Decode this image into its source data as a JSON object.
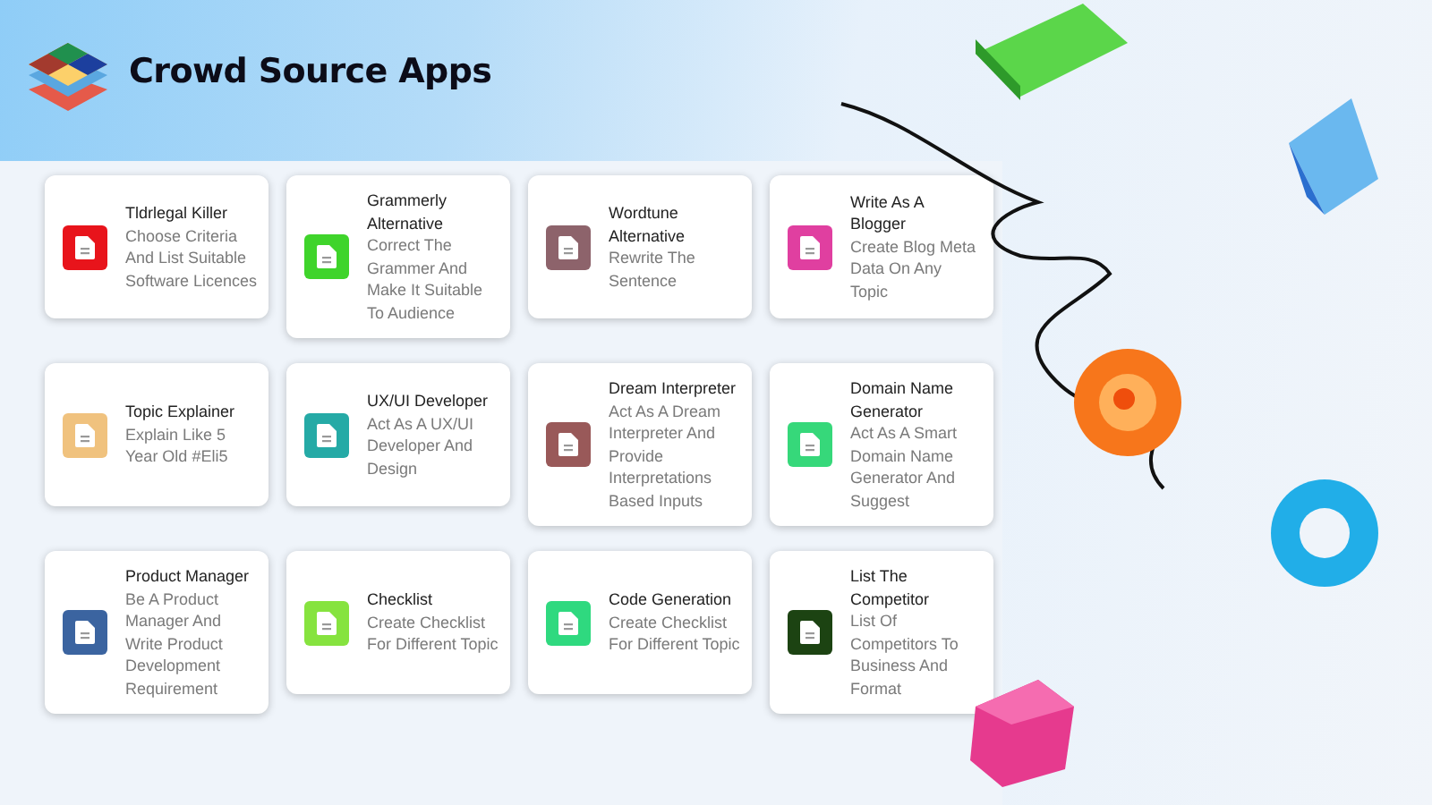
{
  "header": {
    "title": "Crowd Source Apps"
  },
  "apps": [
    {
      "title": "Tldrlegal Killer",
      "description": "Choose Criteria And List Suitable Software Licences",
      "color": "#e8141b"
    },
    {
      "title": "Grammerly Alternative",
      "description": "Correct The Grammer And Make It Suitable To Audience",
      "color": "#3fd42b"
    },
    {
      "title": "Wordtune Alternative",
      "description": "Rewrite The Sentence",
      "color": "#8d636b"
    },
    {
      "title": "Write As A Blogger",
      "description": "Create Blog Meta Data On Any Topic",
      "color": "#e03fa0"
    },
    {
      "title": "Topic Explainer",
      "description": "Explain Like 5 Year Old #Eli5",
      "color": "#f0c27e"
    },
    {
      "title": "UX/UI Developer",
      "description": "Act As A UX/UI Developer And Design",
      "color": "#25aaa6"
    },
    {
      "title": "Dream Interpreter",
      "description": "Act As A Dream Interpreter And Provide Interpretations Based Inputs",
      "color": "#995959"
    },
    {
      "title": "Domain Name Generator",
      "description": "Act As A Smart Domain Name Generator And Suggest",
      "color": "#36d87a"
    },
    {
      "title": "Product Manager",
      "description": "Be A Product Manager And Write Product Development Requirement",
      "color": "#3b64a0"
    },
    {
      "title": "Checklist",
      "description": "Create Checklist For Different Topic",
      "color": "#86e33f"
    },
    {
      "title": "Code Generation",
      "description": "Create Checklist For Different Topic",
      "color": "#2fd97f"
    },
    {
      "title": "List The Competitor",
      "description": "List Of Competitors To Business And Format",
      "color": "#1c4312"
    }
  ]
}
